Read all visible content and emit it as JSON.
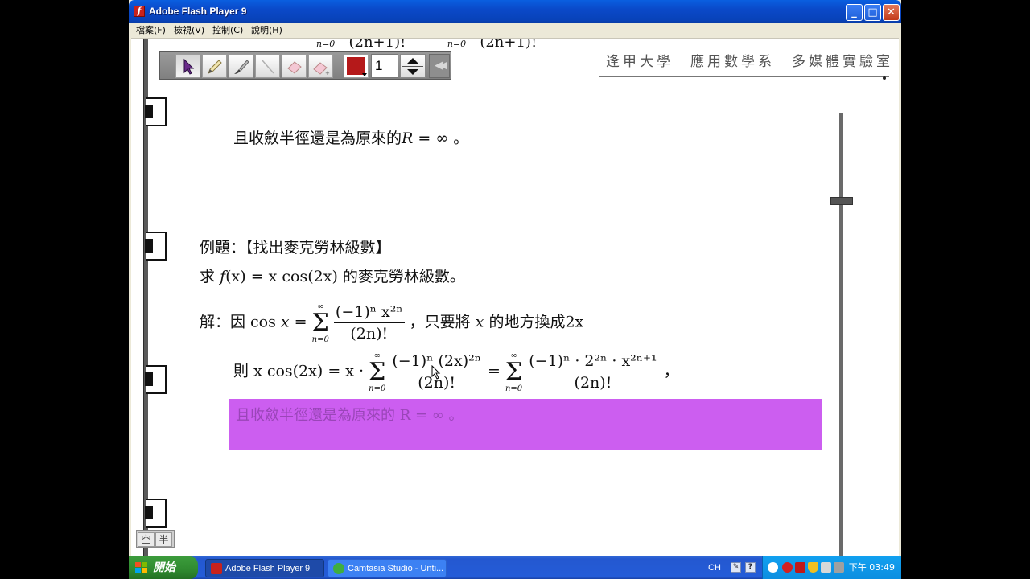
{
  "window": {
    "title": "Adobe Flash Player 9",
    "app_icon": "flash-icon",
    "buttons": {
      "minimize": "_",
      "maximize": "□",
      "close": "✕"
    }
  },
  "menubar": [
    {
      "label": "檔案(F)"
    },
    {
      "label": "檢視(V)"
    },
    {
      "label": "控制(C)"
    },
    {
      "label": "說明(H)"
    }
  ],
  "toolbar": {
    "tools": [
      "arrow-icon",
      "pencil-icon",
      "brush-icon",
      "line-icon",
      "eraser-icon",
      "eraser-plus-icon"
    ],
    "active_tool": "arrow-icon",
    "pen_color": "#b5191a",
    "page_value": "1",
    "rewind": "◀◀"
  },
  "lab_header": "逢甲大學　應用數學系　多媒體實驗室",
  "slide": {
    "prev_radius_line": {
      "text": "且收斂半徑還是為原來的",
      "var": "R",
      "rest": " = ∞ 。"
    },
    "example_title": "例題：【找出麥克勞林級數】",
    "problem": {
      "prefix": "求",
      "f": "f",
      "fx": "(x) = x cos(2x)",
      "suffix": "的麥克勞林級數。"
    },
    "solution": {
      "lead": "解：因 cos",
      "x": "x",
      "eq": " = ",
      "sum_top": "∞",
      "sum_bot": "n=0",
      "num": "(−1)ⁿ x²ⁿ",
      "den": "(2n)!",
      "tail": "，只要將",
      "tail2": "的地方換成",
      "two_x": "2x"
    },
    "then": {
      "lead": "則",
      "lhs": "x cos(2x) = x ·",
      "num1": "(−1)ⁿ (2x)²ⁿ",
      "den1": "(2n)!",
      "eq": " = ",
      "num2": "(−1)ⁿ · 2²ⁿ · x²ⁿ⁺¹",
      "den2": "(2n)!",
      "comma": "，"
    },
    "highlight_text": "且收斂半徑還是為原來的 R = ∞ 。",
    "highlight_color": "#cc5ef0"
  },
  "ime": {
    "left": "空",
    "right": "半"
  },
  "taskbar": {
    "start": "開始",
    "tasks": [
      {
        "label": "Adobe Flash Player 9",
        "icon": "flash-icon",
        "active": true
      },
      {
        "label": "Camtasia Studio - Unti...",
        "icon": "camtasia-icon",
        "active": false
      }
    ],
    "language": "CH",
    "clock": "下午 03:49"
  }
}
